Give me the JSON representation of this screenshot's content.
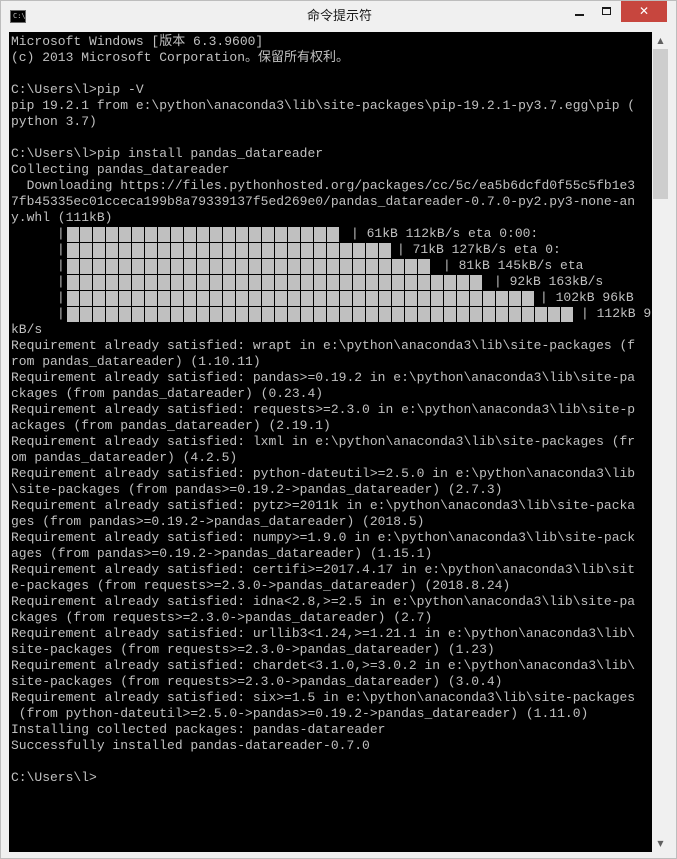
{
  "window": {
    "title": "命令提示符",
    "icon": "console-icon",
    "icon_text": "C:\\",
    "minimize": "–",
    "maximize": "□",
    "close": "✕",
    "close_color": "#c7463e"
  },
  "console": {
    "text_color": "#c0c0c0",
    "background": "#000000",
    "lines_before_progress": [
      "Microsoft Windows [版本 6.3.9600]",
      "(c) 2013 Microsoft Corporation。保留所有权利。",
      "",
      "C:\\Users\\l>pip -V",
      "pip 19.2.1 from e:\\python\\anaconda3\\lib\\site-packages\\pip-19.2.1-py3.7.egg\\pip (",
      "python 3.7)",
      "",
      "C:\\Users\\l>pip install pandas_datareader",
      "Collecting pandas_datareader",
      "  Downloading https://files.pythonhosted.org/packages/cc/5c/ea5b6dcfd0f55c5fb1e3",
      "7fb45335ec01cceca199b8a79339137f5ed269e0/pandas_datareader-0.7.0-py2.py3-none-an",
      "y.whl (111kB)"
    ],
    "progress_rows": [
      {
        "status": "| 61kB 112kB/s eta 0:00:",
        "fill": 0.55
      },
      {
        "status": "| 71kB 127kB/s eta 0:",
        "fill": 0.64
      },
      {
        "status": "| 81kB 145kB/s eta",
        "fill": 0.73
      },
      {
        "status": "| 92kB 163kB/s",
        "fill": 0.83
      },
      {
        "status": "| 102kB 96kB",
        "fill": 0.92
      },
      {
        "status": "| 112kB 96",
        "fill": 1.0
      }
    ],
    "lines_after_progress": [
      "kB/s",
      "Requirement already satisfied: wrapt in e:\\python\\anaconda3\\lib\\site-packages (f",
      "rom pandas_datareader) (1.10.11)",
      "Requirement already satisfied: pandas>=0.19.2 in e:\\python\\anaconda3\\lib\\site-pa",
      "ckages (from pandas_datareader) (0.23.4)",
      "Requirement already satisfied: requests>=2.3.0 in e:\\python\\anaconda3\\lib\\site-p",
      "ackages (from pandas_datareader) (2.19.1)",
      "Requirement already satisfied: lxml in e:\\python\\anaconda3\\lib\\site-packages (fr",
      "om pandas_datareader) (4.2.5)",
      "Requirement already satisfied: python-dateutil>=2.5.0 in e:\\python\\anaconda3\\lib",
      "\\site-packages (from pandas>=0.19.2->pandas_datareader) (2.7.3)",
      "Requirement already satisfied: pytz>=2011k in e:\\python\\anaconda3\\lib\\site-packa",
      "ges (from pandas>=0.19.2->pandas_datareader) (2018.5)",
      "Requirement already satisfied: numpy>=1.9.0 in e:\\python\\anaconda3\\lib\\site-pack",
      "ages (from pandas>=0.19.2->pandas_datareader) (1.15.1)",
      "Requirement already satisfied: certifi>=2017.4.17 in e:\\python\\anaconda3\\lib\\sit",
      "e-packages (from requests>=2.3.0->pandas_datareader) (2018.8.24)",
      "Requirement already satisfied: idna<2.8,>=2.5 in e:\\python\\anaconda3\\lib\\site-pa",
      "ckages (from requests>=2.3.0->pandas_datareader) (2.7)",
      "Requirement already satisfied: urllib3<1.24,>=1.21.1 in e:\\python\\anaconda3\\lib\\",
      "site-packages (from requests>=2.3.0->pandas_datareader) (1.23)",
      "Requirement already satisfied: chardet<3.1.0,>=3.0.2 in e:\\python\\anaconda3\\lib\\",
      "site-packages (from requests>=2.3.0->pandas_datareader) (3.0.4)",
      "Requirement already satisfied: six>=1.5 in e:\\python\\anaconda3\\lib\\site-packages",
      " (from python-dateutil>=2.5.0->pandas>=0.19.2->pandas_datareader) (1.11.0)",
      "Installing collected packages: pandas-datareader",
      "Successfully installed pandas-datareader-0.7.0",
      "",
      "C:\\Users\\l>"
    ]
  },
  "scrollbar": {
    "up_arrow": "▲",
    "down_arrow": "▼",
    "up_icon": "scroll-up-arrow-icon",
    "down_icon": "scroll-down-arrow-icon"
  }
}
